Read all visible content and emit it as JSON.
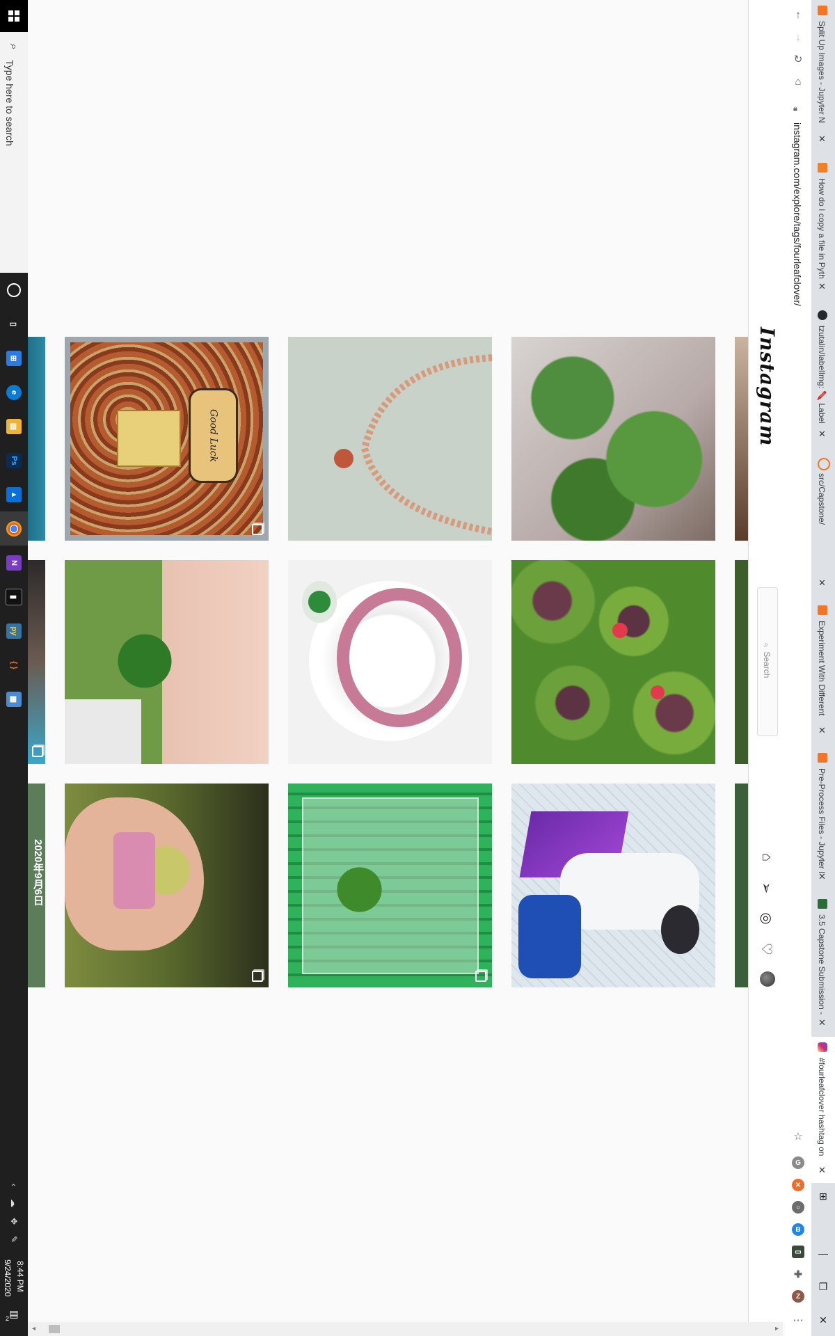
{
  "taskbar": {
    "search_placeholder": "Type here to search",
    "apps": [
      {
        "name": "task-view",
        "glyph": "▯",
        "color": "#1f1f1f"
      },
      {
        "name": "microsoft-store",
        "glyph": "⊞",
        "color": "#2d7be0"
      },
      {
        "name": "edge",
        "glyph": "e",
        "color": "#0c7bd4"
      },
      {
        "name": "file-explorer",
        "glyph": "▤",
        "color": "#f2b233"
      },
      {
        "name": "photoshop",
        "glyph": "Ps",
        "color": "#0a2b52"
      },
      {
        "name": "azure",
        "glyph": "▲",
        "color": "#0a6fd8"
      },
      {
        "name": "chrome",
        "glyph": "◉",
        "color": "#4a4a4a"
      },
      {
        "name": "onenote",
        "glyph": "N",
        "color": "#7b3cc4"
      },
      {
        "name": "terminal",
        "glyph": "▮",
        "color": "#111"
      },
      {
        "name": "python",
        "glyph": "py",
        "color": "#3673a5"
      },
      {
        "name": "jupyter",
        "glyph": "{ }",
        "color": "#f37626"
      },
      {
        "name": "calculator",
        "glyph": "▦",
        "color": "#4a8bd4"
      }
    ],
    "time": "8:44 PM",
    "date": "9/24/2020",
    "notification_count": "2"
  },
  "browser": {
    "url": "instagram.com/explore/tags/fourleafclover/",
    "tabs": [
      {
        "title": "Split Up Images - Jupyter N",
        "favicon_color": "#f37626"
      },
      {
        "title": "How do I copy a file in Pyth",
        "favicon_color": "#f48024"
      },
      {
        "title": "tzutalin/labelImg: 🖍️ Label",
        "favicon_color": "#24292e"
      },
      {
        "title": "src/Capstone/",
        "favicon_color": "#f37626"
      },
      {
        "title": "Experiment With Different",
        "favicon_color": "#f37626"
      },
      {
        "title": "Pre-Process Files - Jupyter N",
        "favicon_color": "#f37626"
      },
      {
        "title": "3.5 Capstone Submission -",
        "favicon_color": "#2b6b3a"
      },
      {
        "title": "#fourleafclover hashtag on",
        "favicon_color": "#d6249f",
        "active": true
      }
    ]
  },
  "instagram": {
    "logo": "Instagram",
    "search_placeholder": "Search"
  },
  "posts": [
    {
      "desc": "teal partial",
      "kind": "partial"
    },
    {
      "desc": "Good Luck card",
      "card_text": "Good Luck"
    },
    {
      "desc": "rose gold bracelet with clover charm"
    },
    {
      "desc": "clover plants in pot"
    },
    {
      "desc": "clover in fingers"
    },
    {
      "desc": "pink bead bracelet"
    },
    {
      "desc": "purple clover flowers"
    },
    {
      "desc": "clover with figurine"
    },
    {
      "desc": "clover on green tray"
    },
    {
      "desc": "person with purple laptop"
    }
  ],
  "partial_overlay_text": "2020年9月6日"
}
